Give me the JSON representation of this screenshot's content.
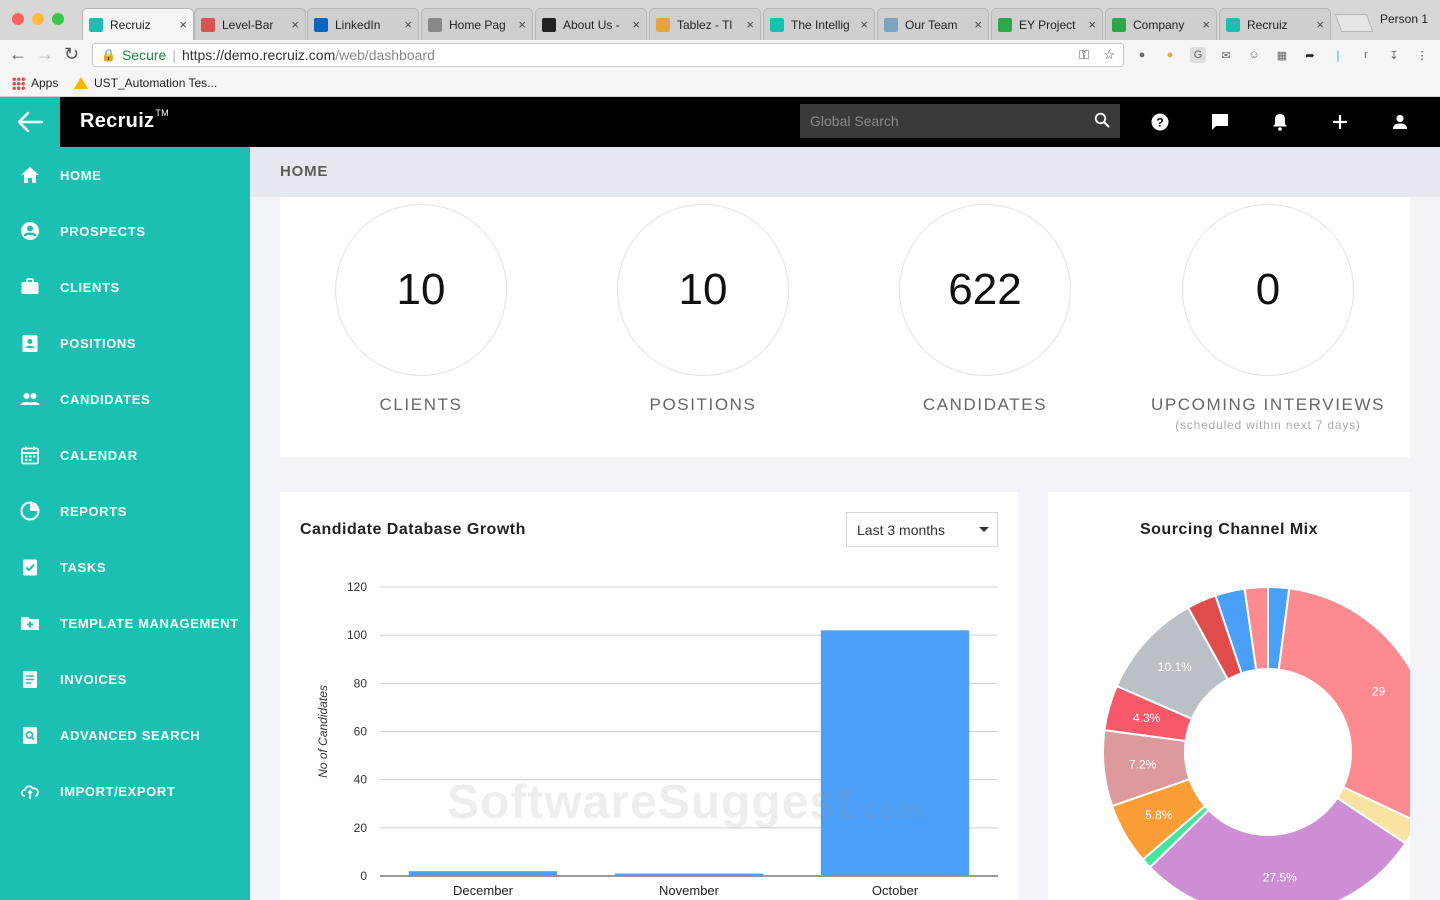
{
  "browser": {
    "tabs": [
      {
        "title": "Recruiz",
        "color": "#1cc0b2",
        "active": true
      },
      {
        "title": "Level-Bar",
        "color": "#d9534f"
      },
      {
        "title": "LinkedIn",
        "color": "#0a66c2"
      },
      {
        "title": "Home Pag",
        "color": "#888888"
      },
      {
        "title": "About Us -",
        "color": "#222222"
      },
      {
        "title": "Tablez - Tl",
        "color": "#e8a33d"
      },
      {
        "title": "The Intellig",
        "color": "#1cc0b2"
      },
      {
        "title": "Our Team",
        "color": "#7aa6c2"
      },
      {
        "title": "EY Project",
        "color": "#2ca84a"
      },
      {
        "title": "Company",
        "color": "#2ca84a"
      },
      {
        "title": "Recruiz",
        "color": "#1cc0b2"
      }
    ],
    "person": "Person 1",
    "secure_label": "Secure",
    "url_host": "https://demo.recruiz.com",
    "url_path": "/web/dashboard",
    "bookmarks": {
      "apps": "Apps",
      "item": "UST_Automation Tes..."
    }
  },
  "header": {
    "logo": "Recruiz",
    "logo_tm": "TM",
    "search_placeholder": "Global Search"
  },
  "sidebar": {
    "items": [
      {
        "label": "HOME",
        "icon": "home-icon"
      },
      {
        "label": "PROSPECTS",
        "icon": "account-circle-icon"
      },
      {
        "label": "CLIENTS",
        "icon": "briefcase-icon"
      },
      {
        "label": "POSITIONS",
        "icon": "badge-icon"
      },
      {
        "label": "CANDIDATES",
        "icon": "people-icon"
      },
      {
        "label": "CALENDAR",
        "icon": "calendar-icon"
      },
      {
        "label": "REPORTS",
        "icon": "pie-chart-icon"
      },
      {
        "label": "TASKS",
        "icon": "task-check-icon"
      },
      {
        "label": "TEMPLATE MANAGEMENT",
        "icon": "folder-plus-icon"
      },
      {
        "label": "INVOICES",
        "icon": "invoice-icon"
      },
      {
        "label": "ADVANCED SEARCH",
        "icon": "search-document-icon"
      },
      {
        "label": "IMPORT/EXPORT",
        "icon": "cloud-sync-icon"
      }
    ]
  },
  "breadcrumb": "HOME",
  "stats": [
    {
      "value": "10",
      "label": "CLIENTS",
      "sub": ""
    },
    {
      "value": "10",
      "label": "POSITIONS",
      "sub": ""
    },
    {
      "value": "622",
      "label": "CANDIDATES",
      "sub": ""
    },
    {
      "value": "0",
      "label": "UPCOMING INTERVIEWS",
      "sub": "(scheduled within next 7 days)"
    }
  ],
  "growth": {
    "title": "Candidate Database Growth",
    "range": "Last 3 months"
  },
  "sourcing": {
    "title": "Sourcing Channel Mix"
  },
  "watermark": {
    "main": "SoftwareSuggest",
    "suffix": ".com"
  },
  "colors": {
    "accent": "#1cc0b2",
    "bar": "#4a9ff8"
  },
  "chart_data": [
    {
      "type": "bar",
      "title": "Candidate Database Growth",
      "ylabel": "No of Candidates",
      "xlabel": "",
      "categories": [
        "December",
        "November",
        "October"
      ],
      "values": [
        2,
        1,
        102
      ],
      "ylim": [
        0,
        120
      ],
      "yticks": [
        0,
        20,
        40,
        60,
        80,
        100,
        120
      ],
      "grid": true,
      "legend": "none"
    },
    {
      "type": "pie",
      "title": "Sourcing Channel Mix",
      "donut": true,
      "slices": [
        {
          "value": 2.0,
          "color": "#4a9ff8",
          "label": ""
        },
        {
          "value": 29.0,
          "color": "#fd8a8f",
          "label": "29"
        },
        {
          "value": 2.3,
          "color": "#f9e3a1",
          "label": ""
        },
        {
          "value": 27.5,
          "color": "#cd8ed6",
          "label": "27.5%"
        },
        {
          "value": 1.0,
          "color": "#48e29f",
          "label": ""
        },
        {
          "value": 5.8,
          "color": "#fa9d35",
          "label": "5.8%"
        },
        {
          "value": 7.2,
          "color": "#dc9a9d",
          "label": "7.2%"
        },
        {
          "value": 4.3,
          "color": "#f7596b",
          "label": "4.3%"
        },
        {
          "value": 10.1,
          "color": "#bac0c6",
          "label": "10.1%"
        },
        {
          "value": 2.8,
          "color": "#e04c4c",
          "label": ""
        },
        {
          "value": 2.8,
          "color": "#4a9ff8",
          "label": ""
        },
        {
          "value": 2.2,
          "color": "#fd8a8f",
          "label": ""
        }
      ]
    }
  ]
}
